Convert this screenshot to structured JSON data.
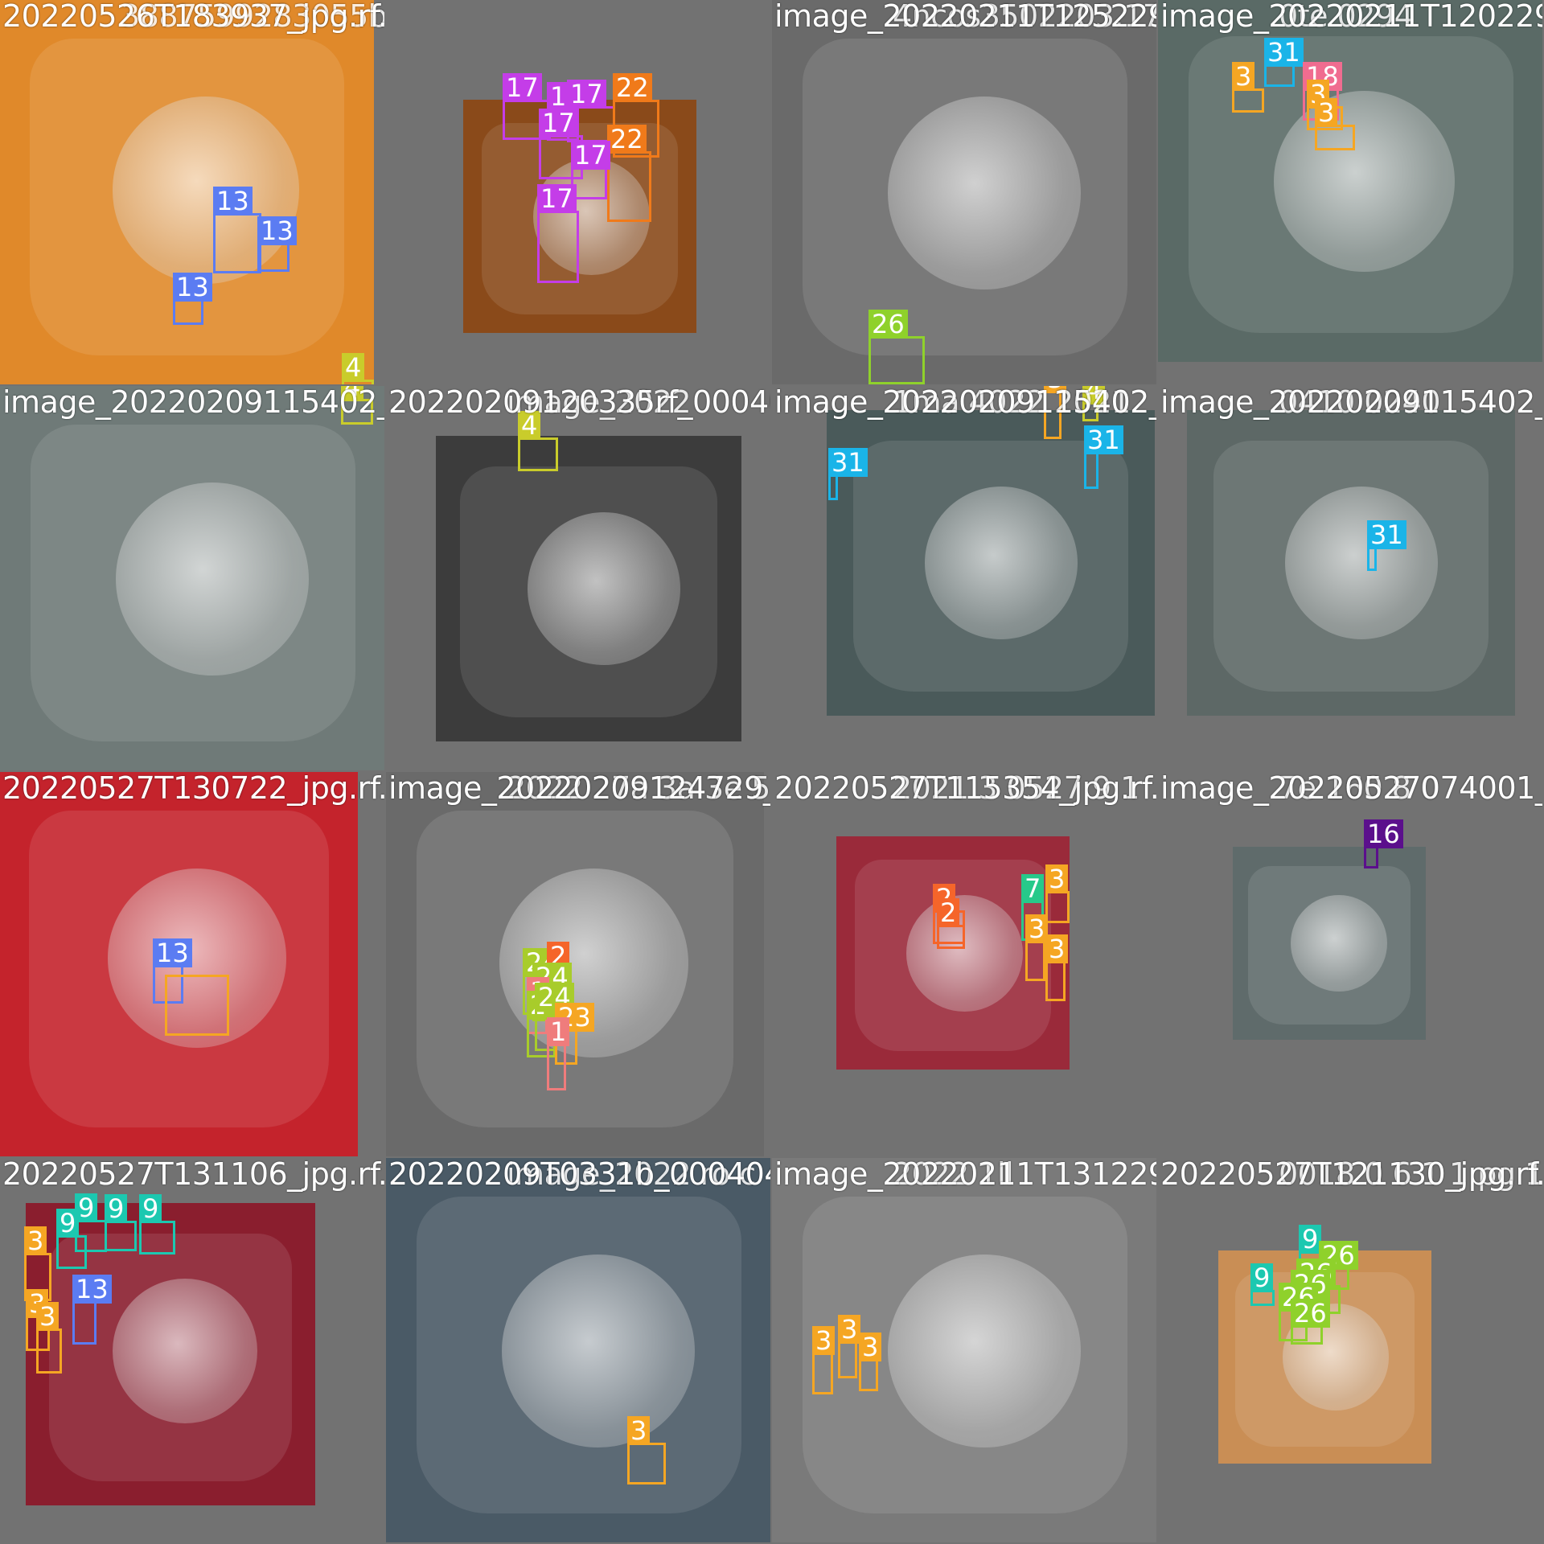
{
  "mosaic": {
    "colors": {
      "bg": "#727272",
      "c1": "#ef7c7c",
      "c2": "#f5652a",
      "c3": "#f5a623",
      "c4": "#c9cc2b",
      "c7": "#27c98a",
      "c9": "#1cc8b0",
      "c13": "#5b7cf2",
      "c16": "#5b0f8c",
      "c17": "#c43de8",
      "c18": "#f06c90",
      "c22": "#f07a1a",
      "c23": "#f5a623",
      "c24": "#a8cc2b",
      "c26": "#8fd12b",
      "c31": "#1ab4e8"
    },
    "tiles": [
      {
        "id": "t0",
        "filename": "20220526T183937_jpg.rf.a2",
        "overlay_filename": "3887599283055b3993978632eec4",
        "photo_bg": "#e0892a",
        "detections": [
          {
            "label": "13",
            "color": "#5b7cf2"
          },
          {
            "label": "13",
            "color": "#5b7cf2"
          },
          {
            "label": "13",
            "color": "#5b7cf2"
          },
          {
            "label": "4",
            "color": "#c9cc2b"
          }
        ]
      },
      {
        "id": "t1",
        "filename": "",
        "photo_bg": "#8a4a1a",
        "detections": [
          {
            "label": "17",
            "color": "#c43de8"
          },
          {
            "label": "1",
            "color": "#c43de8"
          },
          {
            "label": "17",
            "color": "#c43de8"
          },
          {
            "label": "22",
            "color": "#f07a1a"
          },
          {
            "label": "17",
            "color": "#c43de8"
          },
          {
            "label": "22",
            "color": "#f07a1a"
          },
          {
            "label": "17",
            "color": "#c43de8"
          },
          {
            "label": "17",
            "color": "#c43de8"
          }
        ]
      },
      {
        "id": "t2",
        "filename": "image_20220211T125229_0000",
        "overlay_filename": "4ncos3502203.17",
        "photo_bg": "#6a6a6a",
        "detections": [
          {
            "label": "26",
            "color": "#8fd12b"
          }
        ]
      },
      {
        "id": "t3",
        "filename": "image_20220211T120229_00",
        "overlay_filename": "0te 0294",
        "photo_bg": "#5a6a66",
        "detections": [
          {
            "label": "3",
            "color": "#f5a623"
          },
          {
            "label": "31",
            "color": "#1ab4e8"
          },
          {
            "label": "18",
            "color": "#f06c90"
          },
          {
            "label": "3",
            "color": "#f5a623"
          },
          {
            "label": "3",
            "color": "#f5a623"
          }
        ]
      },
      {
        "id": "t4",
        "filename": "image_20220209115402_00",
        "photo_bg": "#6f7a78",
        "detections": [
          {
            "label": "4",
            "color": "#c9cc2b"
          }
        ]
      },
      {
        "id": "t5",
        "filename": "20220209120335rf_000404-0",
        "overlay_filename": "image_2022",
        "photo_bg": "#3c3c3c",
        "detections": [
          {
            "label": "4",
            "color": "#c9cc2b"
          }
        ]
      },
      {
        "id": "t6",
        "filename": "image_20220209115402_000",
        "overlay_filename": "1ma 4022 2021",
        "photo_bg": "#4a5a5a",
        "detections": [
          {
            "label": "3",
            "color": "#f5a623"
          },
          {
            "label": "4",
            "color": "#c9cc2b"
          },
          {
            "label": "31",
            "color": "#1ab4e8"
          },
          {
            "label": "31",
            "color": "#1ab4e8"
          }
        ]
      },
      {
        "id": "t7",
        "filename": "image_20220209115402_00",
        "overlay_filename": "0410 0240",
        "photo_bg": "#5d6866",
        "detections": [
          {
            "label": "31",
            "color": "#1ab4e8"
          }
        ]
      },
      {
        "id": "t8",
        "filename": "20220527T130722_jpg.rf.b2",
        "photo_bg": "#c4232c",
        "detections": [
          {
            "label": "13",
            "color": "#5b7cf2"
          },
          {
            "label": "",
            "color": "#f5a623"
          }
        ]
      },
      {
        "id": "t9",
        "filename": "image_20220209124729_000",
        "overlay_filename": "2022 27a 3a 3e 5b",
        "photo_bg": "#6a6a6a",
        "detections": [
          {
            "label": "24",
            "color": "#a8cc2b"
          },
          {
            "label": "2",
            "color": "#f5652a"
          },
          {
            "label": "24",
            "color": "#a8cc2b"
          },
          {
            "label": "1",
            "color": "#ef7c7c"
          },
          {
            "label": "24",
            "color": "#a8cc2b"
          },
          {
            "label": "24",
            "color": "#a8cc2b"
          },
          {
            "label": "23",
            "color": "#f5a623"
          },
          {
            "label": "1",
            "color": "#ef7c7c"
          }
        ]
      },
      {
        "id": "t10",
        "filename": "20220527T115354_jpg.rf.26f",
        "overlay_filename": "2021 3 0527 9 1",
        "photo_bg": "#9a2a3a",
        "detections": [
          {
            "label": "2",
            "color": "#f5652a"
          },
          {
            "label": "2",
            "color": "#f5652a"
          },
          {
            "label": "7",
            "color": "#27c98a"
          },
          {
            "label": "3",
            "color": "#f5a623"
          },
          {
            "label": "3",
            "color": "#f5a623"
          },
          {
            "label": "3",
            "color": "#f5a623"
          }
        ]
      },
      {
        "id": "t11",
        "filename": "image_20220527074001_00",
        "overlay_filename": "7e 160 8 0",
        "photo_bg": "#5f6b6b",
        "detections": [
          {
            "label": "16",
            "color": "#5b0f8c"
          }
        ]
      },
      {
        "id": "t12",
        "filename": "20220527T131106_jpg.rf.ad",
        "photo_bg": "#8a1e2e",
        "detections": [
          {
            "label": "9",
            "color": "#1cc8b0"
          },
          {
            "label": "9",
            "color": "#1cc8b0"
          },
          {
            "label": "9",
            "color": "#1cc8b0"
          },
          {
            "label": "9",
            "color": "#1cc8b0"
          },
          {
            "label": "3",
            "color": "#f5a623"
          },
          {
            "label": "13",
            "color": "#5b7cf2"
          },
          {
            "label": "3",
            "color": "#f5a623"
          },
          {
            "label": "3",
            "color": "#f5a623"
          }
        ]
      },
      {
        "id": "t13",
        "filename": "20220209T0331b_000404-0",
        "overlay_filename": "image_2022 ro c",
        "photo_bg": "#4a5a66",
        "detections": [
          {
            "label": "3",
            "color": "#f5a623"
          }
        ]
      },
      {
        "id": "t14",
        "filename": "image_20220211T131229_000",
        "overlay_filename": "2022 1ll",
        "photo_bg": "#7a7a7a",
        "detections": [
          {
            "label": "3",
            "color": "#f5a623"
          },
          {
            "label": "3",
            "color": "#f5a623"
          },
          {
            "label": "3",
            "color": "#f5a623"
          }
        ]
      },
      {
        "id": "t15",
        "filename": "20220527T121130_jpg.rf.b7",
        "overlay_filename": "0018 0 6 1 1 pg 1 1",
        "photo_bg": "#c98e55",
        "detections": [
          {
            "label": "9",
            "color": "#1cc8b0"
          },
          {
            "label": "26",
            "color": "#8fd12b"
          },
          {
            "label": "26",
            "color": "#8fd12b"
          },
          {
            "label": "9",
            "color": "#1cc8b0"
          },
          {
            "label": "26",
            "color": "#8fd12b"
          },
          {
            "label": "26",
            "color": "#8fd12b"
          },
          {
            "label": "26",
            "color": "#8fd12b"
          }
        ]
      }
    ]
  }
}
